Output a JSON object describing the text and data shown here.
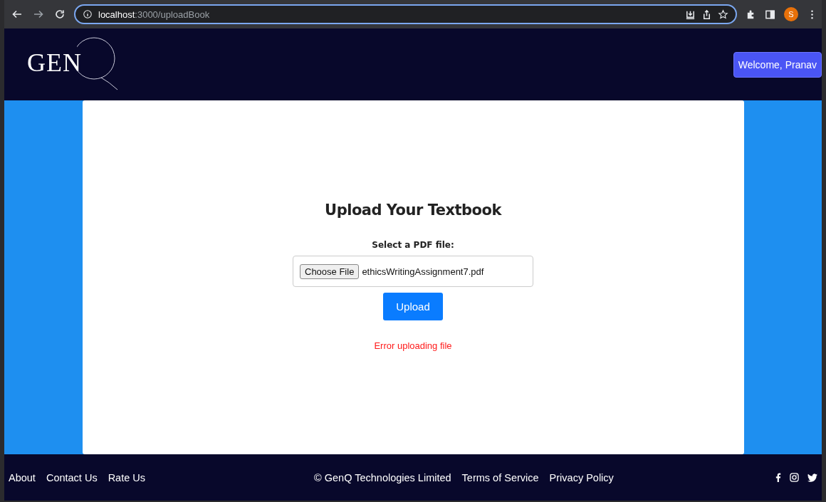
{
  "browser": {
    "url_host": "localhost",
    "url_path": ":3000/uploadBook",
    "avatar": "S"
  },
  "header": {
    "logo": "GEN",
    "user_button": "Welcome, Pranav"
  },
  "upload": {
    "title": "Upload Your Textbook",
    "label": "Select a PDF file:",
    "choose_button": "Choose File",
    "file_name": "ethicsWritingAssignment7.pdf",
    "upload_button": "Upload",
    "error": "Error uploading file"
  },
  "footer": {
    "left_links": [
      "About",
      "Contact Us",
      "Rate Us"
    ],
    "copyright": "© GenQ Technologies Limited",
    "center_links": [
      "Terms of Service",
      "Privacy Policy"
    ]
  }
}
